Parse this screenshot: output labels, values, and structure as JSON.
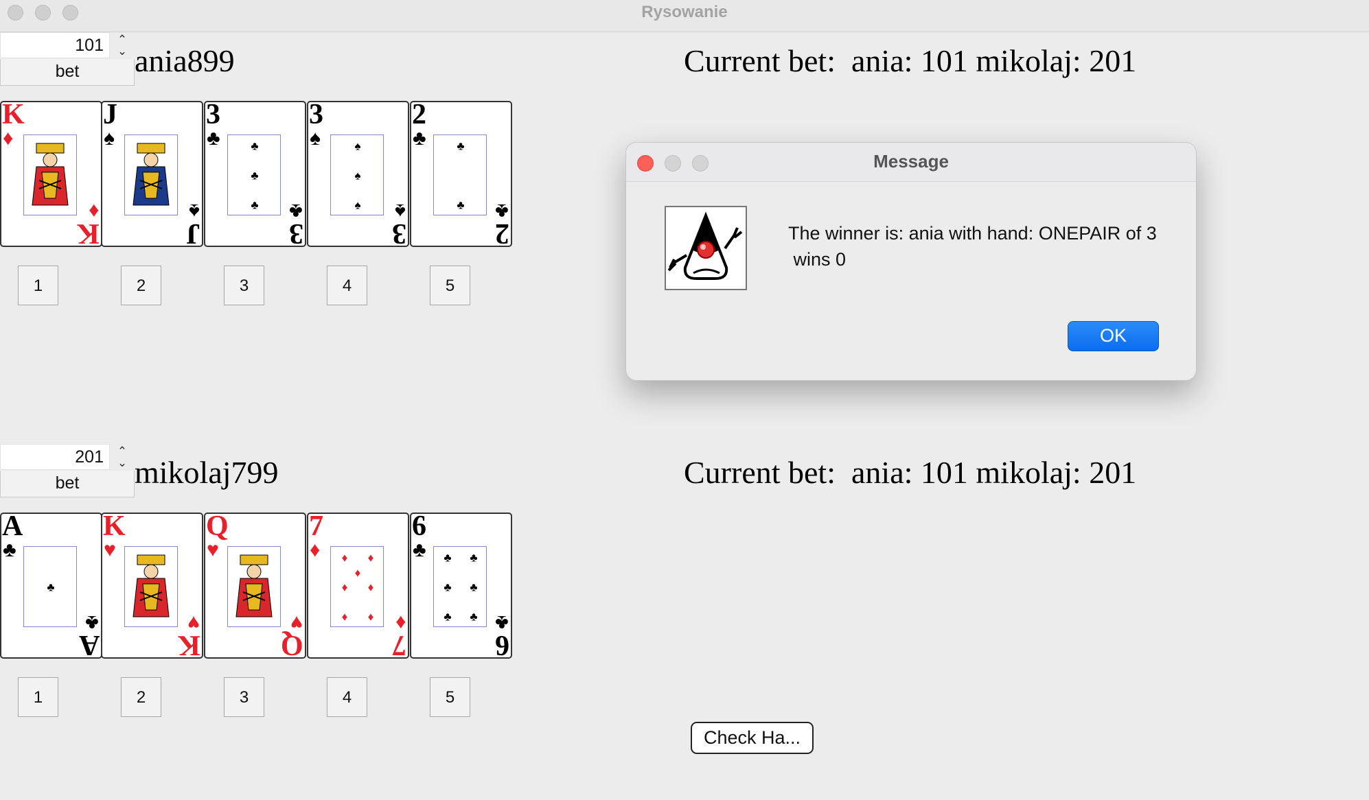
{
  "window": {
    "title": "Rysowanie"
  },
  "player1": {
    "bet_value": "101",
    "bet_label": "bet",
    "name": "ania899",
    "current_bet": "Current bet:  ania: 101 mikolaj: 201",
    "cards": [
      {
        "rank": "K",
        "suit": "♦",
        "color": "red"
      },
      {
        "rank": "J",
        "suit": "♠",
        "color": "black"
      },
      {
        "rank": "3",
        "suit": "♣",
        "color": "black"
      },
      {
        "rank": "3",
        "suit": "♠",
        "color": "black"
      },
      {
        "rank": "2",
        "suit": "♣",
        "color": "black"
      }
    ],
    "buttons": [
      "1",
      "2",
      "3",
      "4",
      "5"
    ]
  },
  "player2": {
    "bet_value": "201",
    "bet_label": "bet",
    "name": "mikolaj799",
    "current_bet": "Current bet:  ania: 101 mikolaj: 201",
    "cards": [
      {
        "rank": "A",
        "suit": "♣",
        "color": "black"
      },
      {
        "rank": "K",
        "suit": "♥",
        "color": "red"
      },
      {
        "rank": "Q",
        "suit": "♥",
        "color": "red"
      },
      {
        "rank": "7",
        "suit": "♦",
        "color": "red"
      },
      {
        "rank": "6",
        "suit": "♣",
        "color": "black"
      }
    ],
    "buttons": [
      "1",
      "2",
      "3",
      "4",
      "5"
    ]
  },
  "check_hand_label": "Check Ha...",
  "dialog": {
    "title": "Message",
    "line1": "The winner is: ania with hand: ONEPAIR of 3",
    "line2": " wins 0",
    "ok_label": "OK",
    "icon": "java-duke-icon"
  },
  "colors": {
    "card_red": "#e8202a",
    "ok_blue": "#0a6df0",
    "close_red": "#fe5f57"
  }
}
